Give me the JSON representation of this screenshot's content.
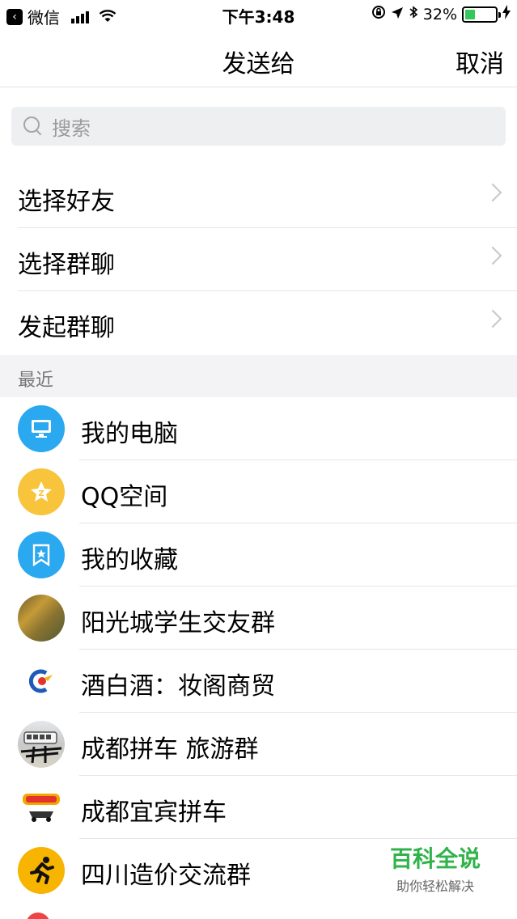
{
  "status_bar": {
    "back_app": "微信",
    "time": "下午3:48",
    "battery_percent": "32%",
    "battery_level": 0.32,
    "battery_color": "#34c759"
  },
  "nav": {
    "title": "发送给",
    "cancel_label": "取消"
  },
  "search": {
    "placeholder": "搜索"
  },
  "actions": [
    {
      "label": "选择好友"
    },
    {
      "label": "选择群聊"
    },
    {
      "label": "发起群聊"
    }
  ],
  "recent": {
    "header": "最近",
    "items": [
      {
        "name": "我的电脑",
        "icon": "computer-icon"
      },
      {
        "name": "QQ空间",
        "icon": "qzone-icon"
      },
      {
        "name": "我的收藏",
        "icon": "bookmark-icon"
      },
      {
        "name": "阳光城学生交友群",
        "icon": "group-photo-avatar"
      },
      {
        "name": "酒白酒：妆阁商贸",
        "icon": "logo-avatar"
      },
      {
        "name": "成都拼车 旅游群",
        "icon": "bus-avatar"
      },
      {
        "name": "成都宜宾拼车",
        "icon": "taxi-avatar"
      },
      {
        "name": "四川造价交流群",
        "icon": "runner-avatar"
      }
    ]
  },
  "watermark": {
    "title": "百科全说",
    "subtitle": "助你轻松解决"
  },
  "colors": {
    "accent_blue": "#2aa8f0",
    "accent_yellow": "#f7c43b",
    "watermark_green": "#2fb34a"
  }
}
